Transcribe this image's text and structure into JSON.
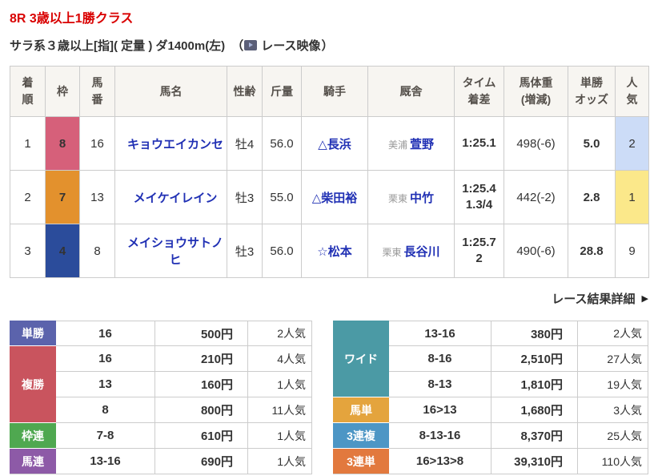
{
  "header": {
    "race_title": "8R 3歳以上1勝クラス",
    "race_conditions": "サラ系３歳以上[指]( 定量 ) ダ1400m(左)",
    "video_paren_open": "（",
    "video_label": "レース映像",
    "video_paren_close": "）"
  },
  "results": {
    "columns": [
      "着\n順",
      "枠",
      "馬\n番",
      "馬名",
      "性齢",
      "斤量",
      "騎手",
      "厩舎",
      "タイム\n着差",
      "馬体重\n(増減)",
      "単勝\nオッズ",
      "人\n気"
    ],
    "rows": [
      {
        "pos": "1",
        "frame": "8",
        "frame_color": "#d6607a",
        "num": "16",
        "name": "キョウエイカンセ",
        "sex_age": "牡4",
        "weight": "56.0",
        "jockey": "△長浜",
        "stable_region": "美浦",
        "stable_name": "萱野",
        "time": "1:25.1",
        "margin": "",
        "horse_weight": "498(-6)",
        "odds": "5.0",
        "fav": "2",
        "fav_bg": "#ccdcf7"
      },
      {
        "pos": "2",
        "frame": "7",
        "frame_color": "#e3912d",
        "num": "13",
        "name": "メイケイレイン",
        "sex_age": "牡3",
        "weight": "55.0",
        "jockey": "△柴田裕",
        "stable_region": "栗東",
        "stable_name": "中竹",
        "time": "1:25.4",
        "margin": "1.3/4",
        "horse_weight": "442(-2)",
        "odds": "2.8",
        "fav": "1",
        "fav_bg": "#fbe88a"
      },
      {
        "pos": "3",
        "frame": "4",
        "frame_color": "#2b4c9b",
        "num": "8",
        "name": "メイショウサトノヒ",
        "sex_age": "牡3",
        "weight": "56.0",
        "jockey": "☆松本",
        "stable_region": "栗東",
        "stable_name": "長谷川",
        "time": "1:25.7",
        "margin": "2",
        "horse_weight": "490(-6)",
        "odds": "28.8",
        "fav": "9",
        "fav_bg": ""
      }
    ]
  },
  "detail_link": {
    "label": "レース結果詳細",
    "arrow": "▶"
  },
  "payouts": {
    "left": [
      {
        "label": "単勝",
        "color": "#5b63ac",
        "rows": [
          [
            "16",
            "500円",
            "2人気"
          ]
        ]
      },
      {
        "label": "複勝",
        "color": "#c9545e",
        "rows": [
          [
            "16",
            "210円",
            "4人気"
          ],
          [
            "13",
            "160円",
            "1人気"
          ],
          [
            "8",
            "800円",
            "11人気"
          ]
        ]
      },
      {
        "label": "枠連",
        "color": "#4fa850",
        "rows": [
          [
            "7-8",
            "610円",
            "1人気"
          ]
        ]
      },
      {
        "label": "馬連",
        "color": "#8d5aa7",
        "rows": [
          [
            "13-16",
            "690円",
            "1人気"
          ]
        ]
      }
    ],
    "right": [
      {
        "label": "ワイド",
        "color": "#4b9aa5",
        "rows": [
          [
            "13-16",
            "380円",
            "2人気"
          ],
          [
            "8-16",
            "2,510円",
            "27人気"
          ],
          [
            "8-13",
            "1,810円",
            "19人気"
          ]
        ]
      },
      {
        "label": "馬単",
        "color": "#e4a43d",
        "rows": [
          [
            "16>13",
            "1,680円",
            "3人気"
          ]
        ]
      },
      {
        "label": "3連複",
        "color": "#4d96c5",
        "rows": [
          [
            "8-13-16",
            "8,370円",
            "25人気"
          ]
        ]
      },
      {
        "label": "3連単",
        "color": "#e2793e",
        "rows": [
          [
            "16>13>8",
            "39,310円",
            "110人気"
          ]
        ]
      }
    ]
  }
}
